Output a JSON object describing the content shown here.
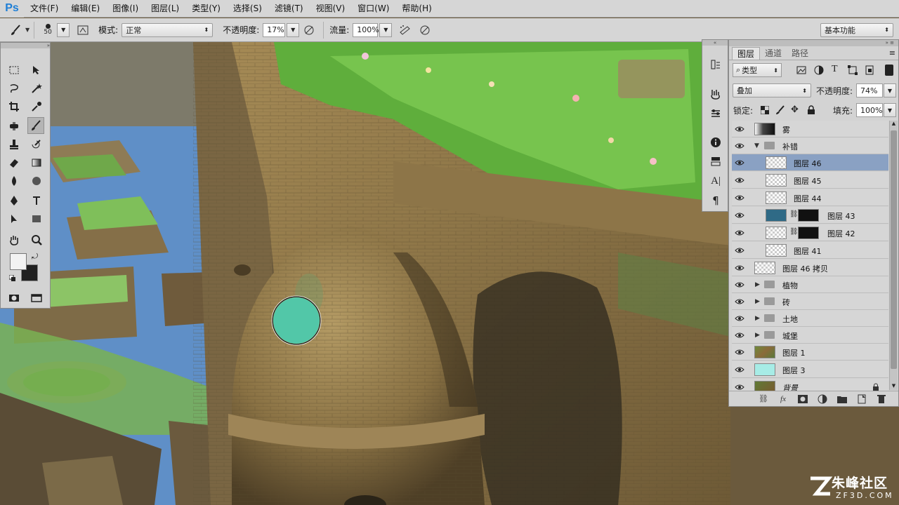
{
  "app": {
    "logo": "Ps"
  },
  "menu": [
    "文件(F)",
    "编辑(E)",
    "图像(I)",
    "图层(L)",
    "类型(Y)",
    "选择(S)",
    "滤镜(T)",
    "视图(V)",
    "窗口(W)",
    "帮助(H)"
  ],
  "options": {
    "brush_size": "50",
    "mode_label": "模式:",
    "mode_value": "正常",
    "opacity_label": "不透明度:",
    "opacity_value": "17%",
    "flow_label": "流量:",
    "flow_value": "100%",
    "workspace": "基本功能"
  },
  "layers_panel": {
    "tabs": [
      "图层",
      "通道",
      "路径"
    ],
    "filter_kind": "类型",
    "blend_mode": "叠加",
    "opacity_label": "不透明度:",
    "opacity_value": "74%",
    "lock_label": "锁定:",
    "fill_label": "填充:",
    "fill_value": "100%",
    "layers": [
      {
        "name": "雾",
        "kind": "layer",
        "selected": false
      },
      {
        "name": "补错",
        "kind": "group-open",
        "selected": false
      },
      {
        "name": "图层 46",
        "kind": "layer",
        "selected": true
      },
      {
        "name": "图层 45",
        "kind": "layer",
        "selected": false
      },
      {
        "name": "图层 44",
        "kind": "layer",
        "selected": false
      },
      {
        "name": "图层 43",
        "kind": "masked",
        "selected": false
      },
      {
        "name": "图层 42",
        "kind": "masked",
        "selected": false
      },
      {
        "name": "图层 41",
        "kind": "layer",
        "selected": false
      },
      {
        "name": "图层 46 拷贝",
        "kind": "layer",
        "selected": false
      },
      {
        "name": "植物",
        "kind": "group",
        "selected": false
      },
      {
        "name": "砖",
        "kind": "group",
        "selected": false
      },
      {
        "name": "土地",
        "kind": "group",
        "selected": false
      },
      {
        "name": "城堡",
        "kind": "group",
        "selected": false
      },
      {
        "name": "图层 1",
        "kind": "layer",
        "selected": false
      },
      {
        "name": "图层 3",
        "kind": "layer",
        "selected": false
      },
      {
        "name": "背景",
        "kind": "locked",
        "selected": false
      }
    ]
  },
  "colors": {
    "foreground": "#f2f2f2",
    "background": "#202020",
    "selected_row": "#8aa1c3"
  },
  "watermark": {
    "cn": "朱峰社区",
    "en": "ZF3D.COM"
  }
}
